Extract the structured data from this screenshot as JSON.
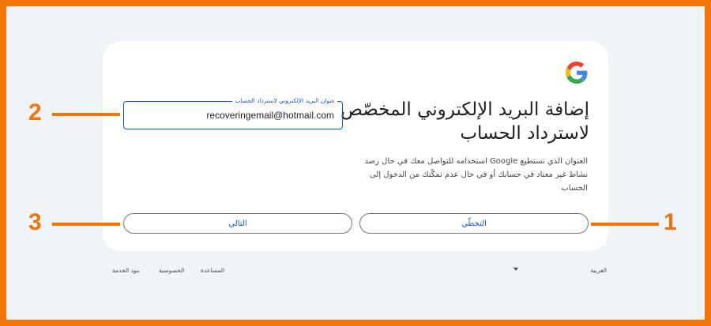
{
  "card": {
    "title": "إضافة البريد الإلكتروني المخصّص لاسترداد الحساب",
    "description": "العنوان الذي تستطيع Google استخدامه للتواصل معك في حال رصد نشاط غير معتاد في حسابك أو في حال عدم تمكّنك من الدخول إلى الحساب",
    "recovery_field": {
      "label": "عنوان البريد الإلكتروني لاسترداد الحساب",
      "value": "recoveringemail@hotmail.com"
    },
    "skip_label": "التخطّي",
    "next_label": "التالي"
  },
  "footer": {
    "language": "العربية",
    "help": "المساعدة",
    "privacy": "الخصوصية",
    "terms": "بنود الخدمة"
  },
  "annotations": {
    "one": "1",
    "two": "2",
    "three": "3"
  },
  "colors": {
    "annotation": "#f27405",
    "accent": "#0b57d0",
    "background": "#f0f4f9"
  },
  "icons": [
    "google-logo-icon",
    "dropdown-caret-icon"
  ]
}
